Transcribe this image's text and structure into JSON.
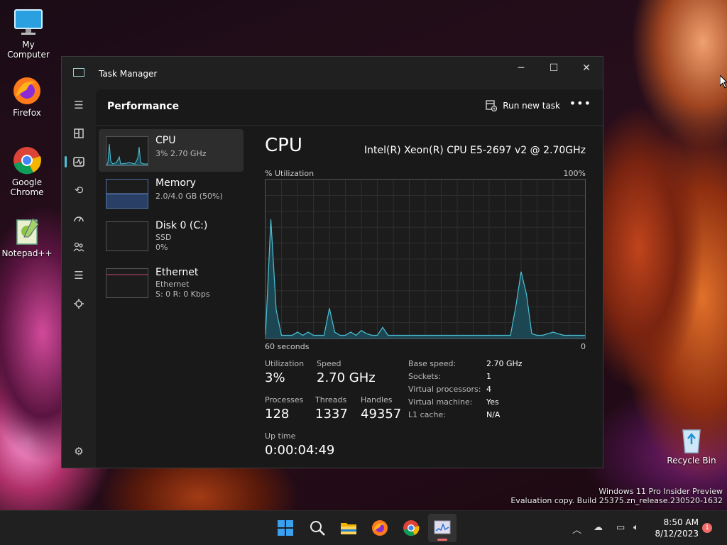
{
  "desktop": {
    "icons": [
      {
        "label": "My Computer",
        "icon": "monitor-icon"
      },
      {
        "label": "Firefox",
        "icon": "firefox-icon"
      },
      {
        "label": "Google Chrome",
        "icon": "chrome-icon"
      },
      {
        "label": "Notepad++",
        "icon": "notepadpp-icon"
      },
      {
        "label": "Recycle Bin",
        "icon": "recycle-bin-icon"
      }
    ],
    "watermark": {
      "line1": "Windows 11 Pro Insider Preview",
      "line2": "Evaluation copy. Build 25375.zn_release.230520-1632"
    }
  },
  "window": {
    "title": "Task Manager",
    "page_title": "Performance",
    "run_new_task": "Run new task",
    "more": "•••"
  },
  "perf_list": [
    {
      "name": "CPU",
      "sub1": "3% 2.70 GHz",
      "sub2": "",
      "sub3": ""
    },
    {
      "name": "Memory",
      "sub1": "2.0/4.0 GB (50%)",
      "sub2": "",
      "sub3": ""
    },
    {
      "name": "Disk 0 (C:)",
      "sub1": "SSD",
      "sub2": "0%",
      "sub3": ""
    },
    {
      "name": "Ethernet",
      "sub1": "Ethernet",
      "sub2": "S: 0 R: 0 Kbps",
      "sub3": ""
    }
  ],
  "detail": {
    "title": "CPU",
    "model": "Intel(R) Xeon(R) CPU E5-2697 v2 @ 2.70GHz",
    "util_label": "% Utilization",
    "util_max": "100%",
    "time_label": "60 seconds",
    "time_end": "0",
    "stats": {
      "utilization_label": "Utilization",
      "utilization": "3%",
      "speed_label": "Speed",
      "speed": "2.70 GHz",
      "processes_label": "Processes",
      "processes": "128",
      "threads_label": "Threads",
      "threads": "1337",
      "handles_label": "Handles",
      "handles": "49357",
      "uptime_label": "Up time",
      "uptime": "0:00:04:49"
    },
    "specs": [
      {
        "k": "Base speed:",
        "v": "2.70 GHz"
      },
      {
        "k": "Sockets:",
        "v": "1"
      },
      {
        "k": "Virtual processors:",
        "v": "4"
      },
      {
        "k": "Virtual machine:",
        "v": "Yes"
      },
      {
        "k": "L1 cache:",
        "v": "N/A"
      }
    ]
  },
  "chart_data": {
    "type": "area",
    "title": "",
    "xlabel": "60 seconds",
    "ylabel": "% Utilization",
    "ylim": [
      0,
      100
    ],
    "x": [
      60,
      59,
      58,
      57,
      56,
      55,
      54,
      53,
      52,
      51,
      50,
      49,
      48,
      47,
      46,
      45,
      44,
      43,
      42,
      41,
      40,
      39,
      38,
      37,
      36,
      35,
      34,
      33,
      32,
      31,
      30,
      29,
      28,
      27,
      26,
      25,
      24,
      23,
      22,
      21,
      20,
      19,
      18,
      17,
      16,
      15,
      14,
      13,
      12,
      11,
      10,
      9,
      8,
      7,
      6,
      5,
      4,
      3,
      2,
      1,
      0
    ],
    "series": [
      {
        "values": [
          2,
          75,
          18,
          2,
          2,
          2,
          4,
          2,
          4,
          2,
          2,
          2,
          19,
          4,
          2,
          2,
          4,
          2,
          5,
          3,
          2,
          2,
          7,
          2,
          2,
          2,
          2,
          2,
          2,
          2,
          2,
          2,
          2,
          2,
          2,
          2,
          2,
          2,
          2,
          2,
          2,
          2,
          2,
          2,
          2,
          2,
          2,
          20,
          42,
          28,
          3,
          2,
          2,
          3,
          4,
          3,
          2,
          2,
          2,
          2,
          2
        ]
      }
    ],
    "grid": true,
    "color": "#4cc2d6"
  },
  "taskbar": {
    "time": "8:50 AM",
    "date": "8/12/2023",
    "notification_count": "1"
  }
}
